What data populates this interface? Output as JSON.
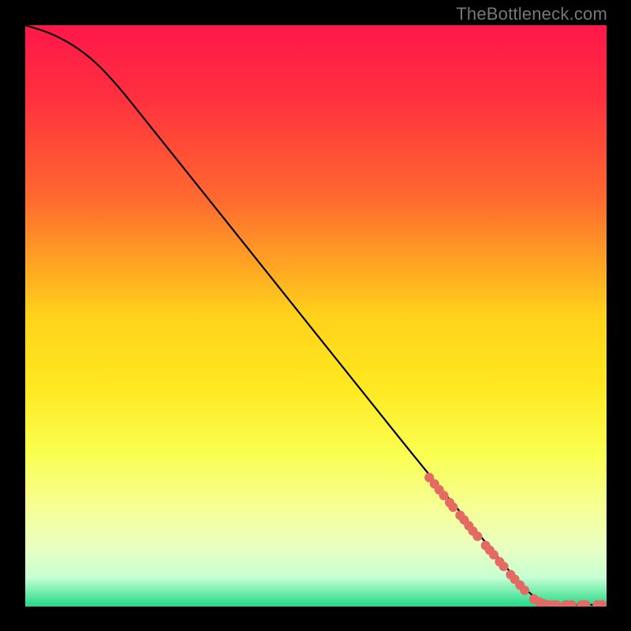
{
  "watermark": "TheBottleneck.com",
  "chart_data": {
    "type": "line",
    "title": "",
    "xlabel": "",
    "ylabel": "",
    "xlim": [
      0,
      100
    ],
    "ylim": [
      0,
      100
    ],
    "gradient_stops": [
      {
        "pct": 0,
        "color": "#ff174a"
      },
      {
        "pct": 12,
        "color": "#ff2f3f"
      },
      {
        "pct": 30,
        "color": "#ff6a2f"
      },
      {
        "pct": 50,
        "color": "#ffd21b"
      },
      {
        "pct": 62,
        "color": "#ffe820"
      },
      {
        "pct": 74,
        "color": "#faff52"
      },
      {
        "pct": 82,
        "color": "#f7ff8f"
      },
      {
        "pct": 90,
        "color": "#e9ffc2"
      },
      {
        "pct": 95,
        "color": "#c6ffd3"
      },
      {
        "pct": 100,
        "color": "#23d986"
      }
    ],
    "series": [
      {
        "name": "bottleneck-curve",
        "color": "#000000",
        "points_xy": [
          [
            0,
            100
          ],
          [
            4,
            98.8
          ],
          [
            8,
            96.8
          ],
          [
            12,
            93.8
          ],
          [
            16,
            89.5
          ],
          [
            20,
            84.5
          ],
          [
            28,
            74.5
          ],
          [
            40,
            59.5
          ],
          [
            55,
            40.7
          ],
          [
            70,
            22.0
          ],
          [
            78,
            12.5
          ],
          [
            85,
            4.0
          ],
          [
            88,
            1.2
          ],
          [
            90,
            0.3
          ],
          [
            100,
            0.3
          ]
        ]
      },
      {
        "name": "highlight-dots",
        "color": "#e46a63",
        "marker": "circle",
        "points_xy": [
          [
            69.5,
            22.2
          ],
          [
            70.4,
            21.1
          ],
          [
            71.2,
            20.1
          ],
          [
            72.0,
            19.1
          ],
          [
            73.0,
            17.9
          ],
          [
            73.6,
            17.1
          ],
          [
            74.8,
            15.7
          ],
          [
            75.5,
            14.9
          ],
          [
            76.3,
            13.9
          ],
          [
            77.0,
            13.0
          ],
          [
            77.8,
            12.1
          ],
          [
            79.2,
            10.5
          ],
          [
            79.9,
            9.7
          ],
          [
            80.6,
            8.9
          ],
          [
            81.6,
            7.7
          ],
          [
            82.3,
            6.9
          ],
          [
            83.5,
            5.5
          ],
          [
            84.2,
            4.7
          ],
          [
            85.1,
            3.7
          ],
          [
            85.9,
            2.8
          ],
          [
            87.5,
            1.3
          ],
          [
            88.4,
            0.8
          ],
          [
            89.2,
            0.5
          ],
          [
            89.9,
            0.3
          ],
          [
            90.6,
            0.3
          ],
          [
            91.4,
            0.3
          ],
          [
            93.0,
            0.3
          ],
          [
            94.0,
            0.3
          ],
          [
            95.7,
            0.3
          ],
          [
            96.4,
            0.3
          ],
          [
            98.4,
            0.3
          ],
          [
            99.2,
            0.3
          ]
        ]
      }
    ]
  }
}
